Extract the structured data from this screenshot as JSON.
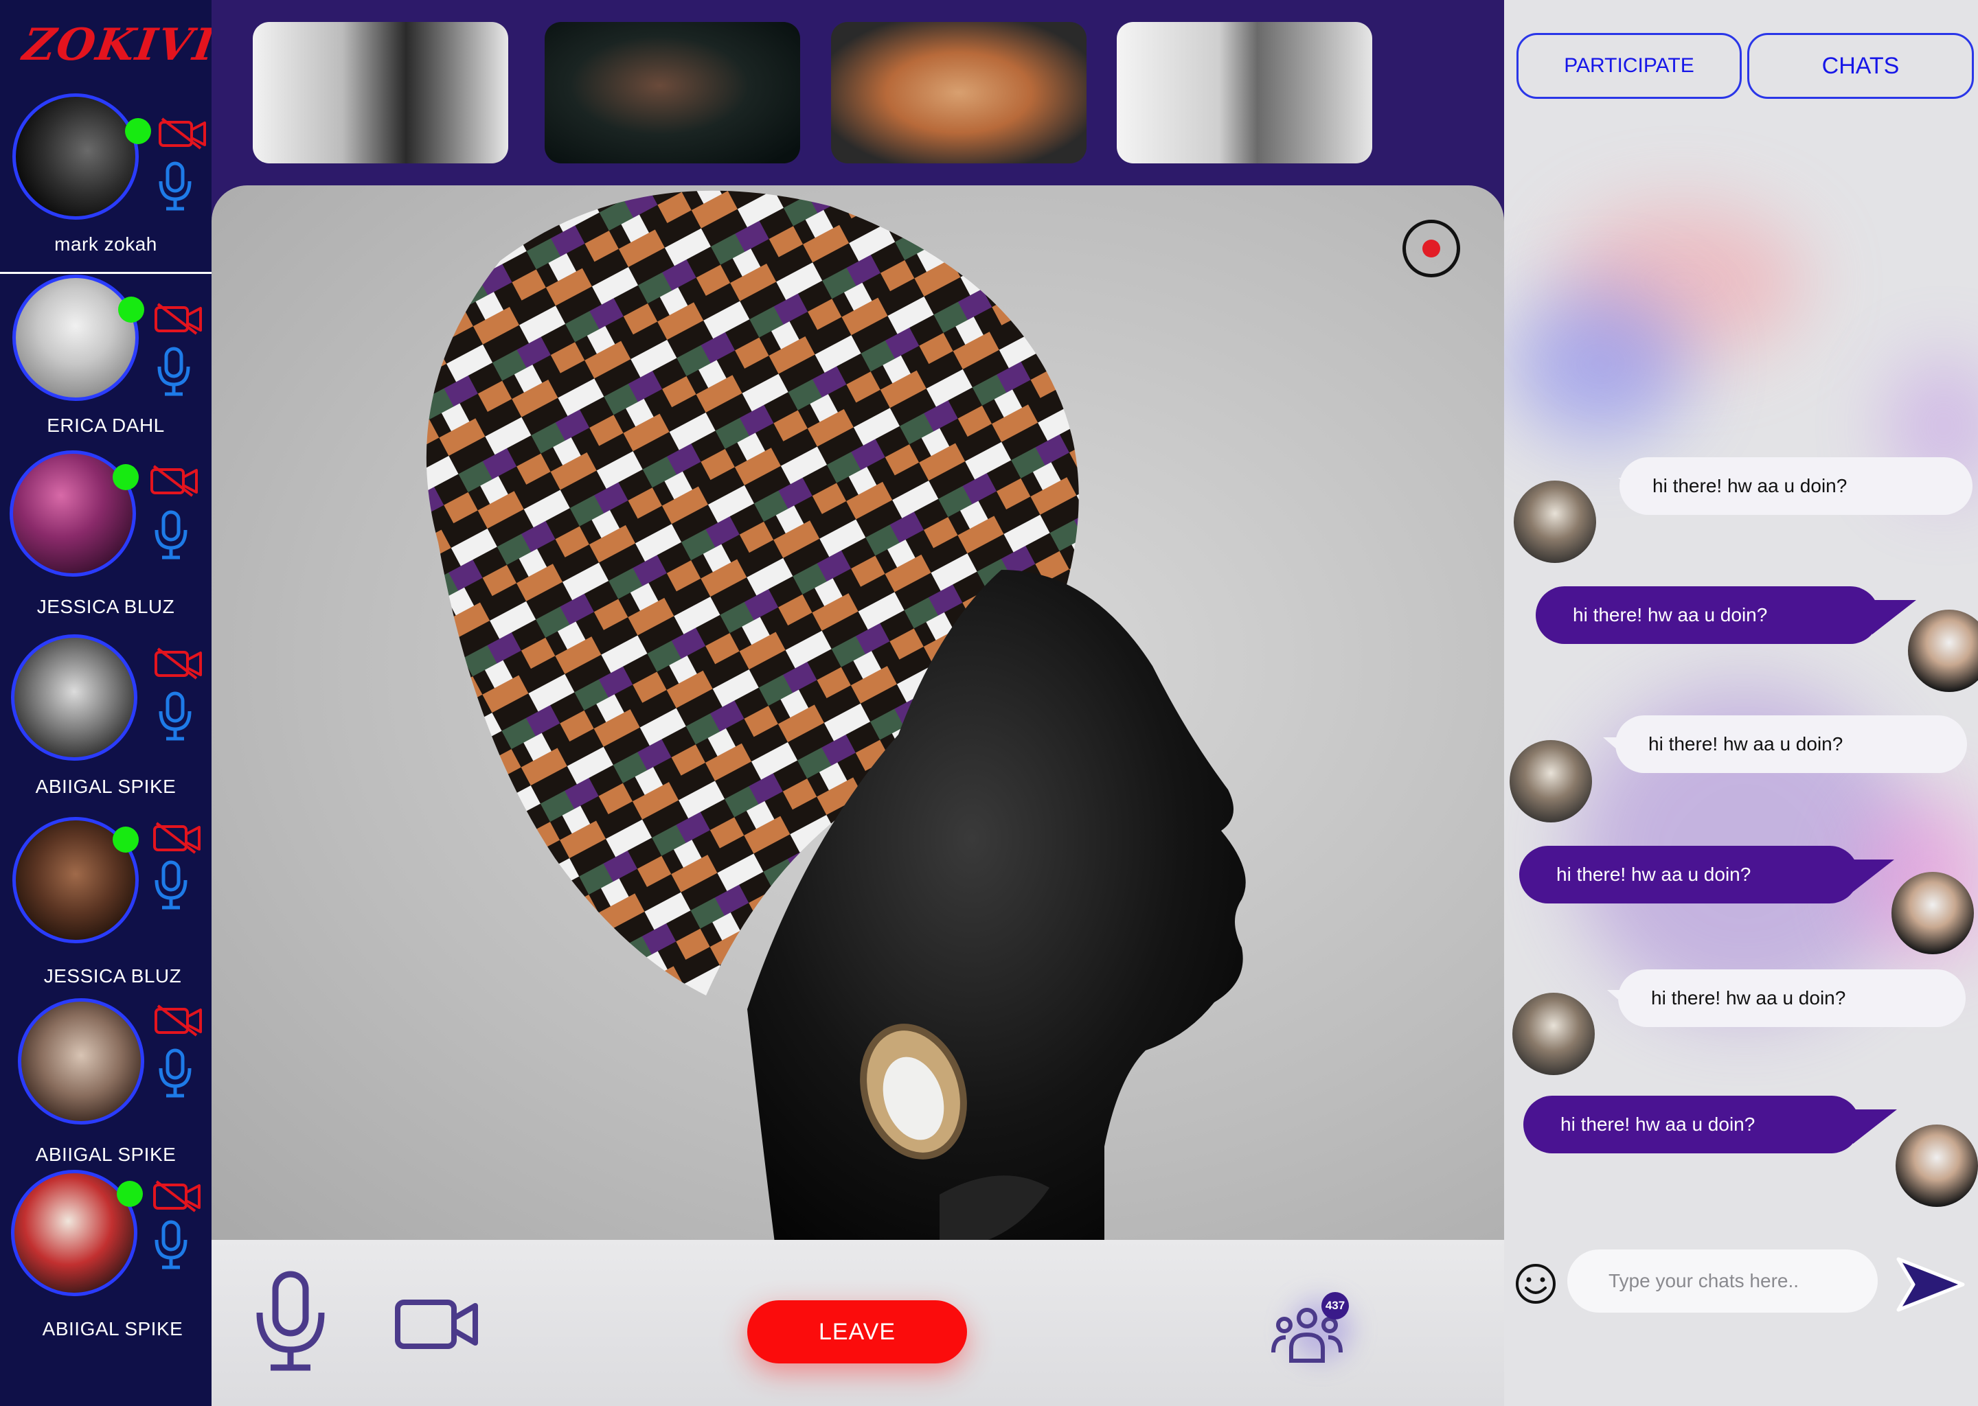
{
  "app": {
    "brand": "ZOKIVID"
  },
  "participants": [
    {
      "name": "mark zokah",
      "online": true
    },
    {
      "name": "ERICA DAHL",
      "online": true
    },
    {
      "name": "JESSICA BLUZ",
      "online": true
    },
    {
      "name": "ABIIGAL SPIKE",
      "online": false
    },
    {
      "name": "JESSICA BLUZ",
      "online": true
    },
    {
      "name": "ABIIGAL SPIKE",
      "online": false
    },
    {
      "name": "ABIIGAL SPIKE",
      "online": true
    }
  ],
  "controls": {
    "leave_label": "LEAVE",
    "participants_count": "437"
  },
  "chat_panel": {
    "tabs": {
      "participate": "PARTICIPATE",
      "chats": "CHATS"
    },
    "messages": [
      {
        "direction": "in",
        "text": "hi there! hw aa u doin?"
      },
      {
        "direction": "out",
        "text": "hi there! hw aa u doin?"
      },
      {
        "direction": "in",
        "text": "hi there! hw aa u doin?"
      },
      {
        "direction": "out",
        "text": "hi there! hw aa u doin?"
      },
      {
        "direction": "in",
        "text": "hi there! hw aa u doin?"
      },
      {
        "direction": "out",
        "text": "hi there! hw aa u doin?"
      }
    ],
    "input_placeholder": "Type your chats here.."
  },
  "colors": {
    "sidebar_bg": "#0f1048",
    "stage_bg": "#2d1a6a",
    "brand": "#e4141e",
    "online_dot": "#17ea11",
    "camera_off": "#e4141e",
    "mic": "#1e7be8",
    "leave_button": "#fb0c0c",
    "outgoing_bubble": "#4a1392",
    "incoming_bubble": "#f3f2f7",
    "tab_border": "#2a36e8",
    "control_icon": "#4b3a8a"
  },
  "icons": {
    "camera_off": "video-off-icon",
    "mic": "microphone-icon",
    "record": "record-icon",
    "control_mic": "microphone-icon",
    "control_cam": "video-camera-icon",
    "participants": "group-icon",
    "emoji": "smiley-icon",
    "send": "send-arrow-icon"
  }
}
